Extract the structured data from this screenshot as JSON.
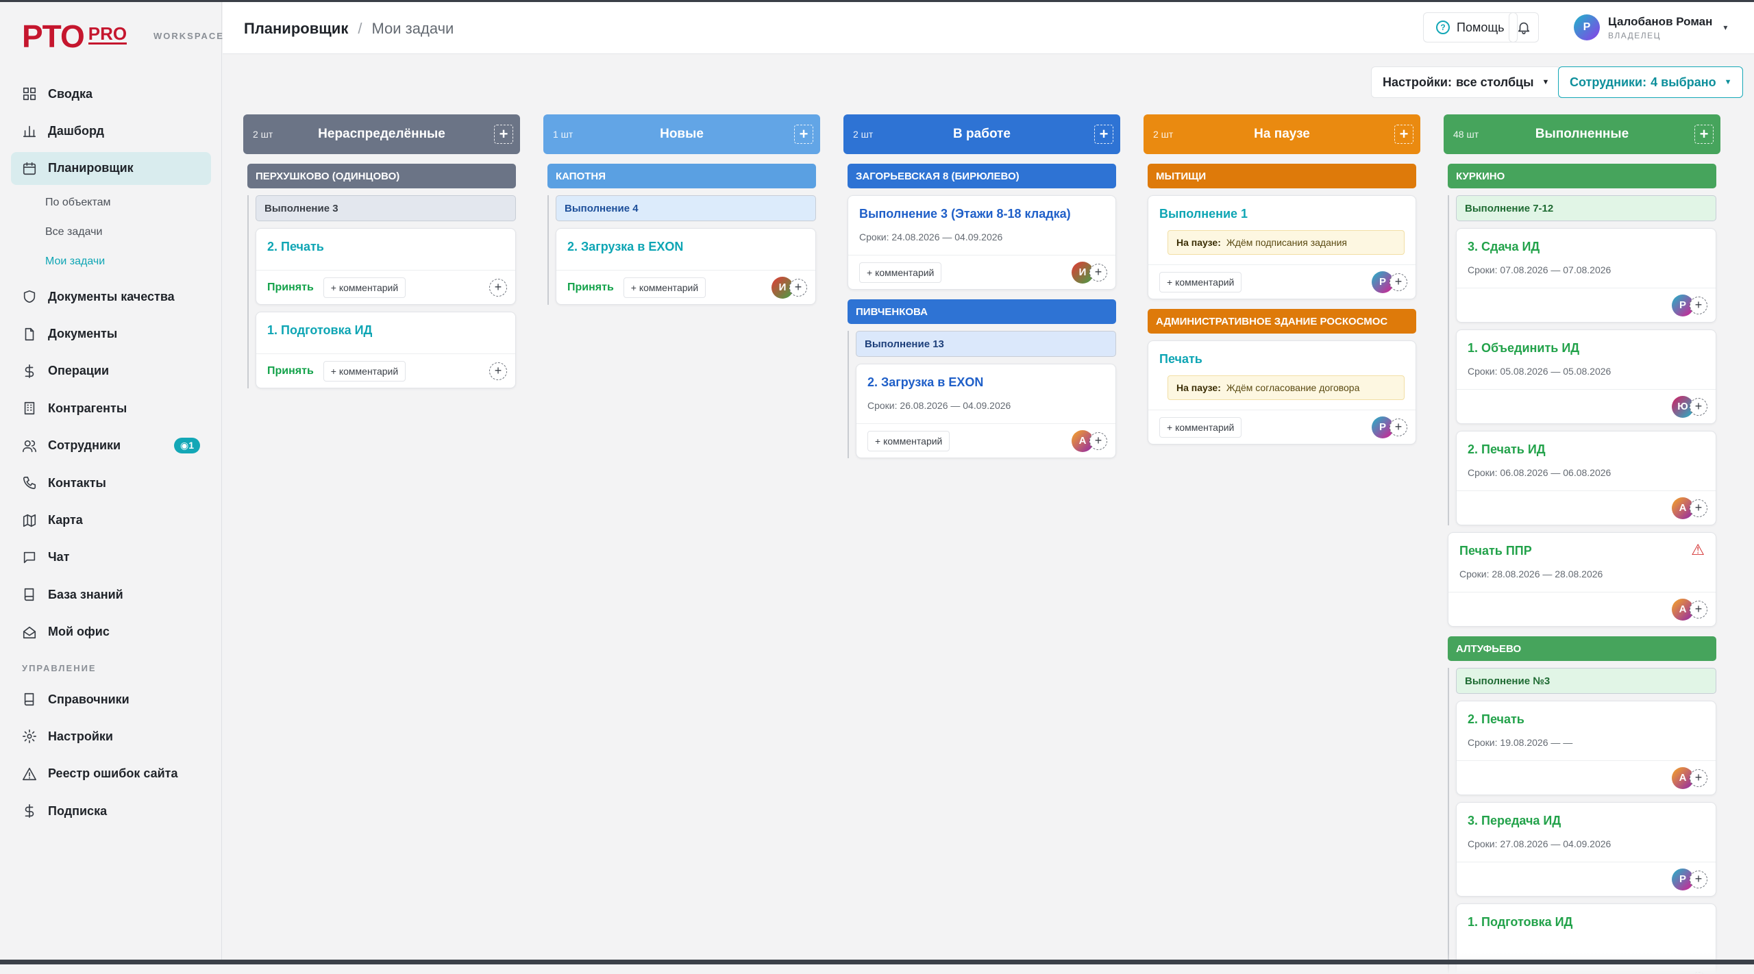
{
  "brand": {
    "name": "PTO",
    "suffix": "PRO",
    "tagline": "WORKSPACE",
    "color": "#c5162e"
  },
  "nav": [
    {
      "label": "Сводка",
      "icon": "grid-icon"
    },
    {
      "label": "Дашборд",
      "icon": "bar-chart-icon"
    },
    {
      "label": "Планировщик",
      "icon": "calendar-icon",
      "active": true
    },
    {
      "label": "Документы качества",
      "icon": "shield-icon"
    },
    {
      "label": "Документы",
      "icon": "file-icon"
    },
    {
      "label": "Операции",
      "icon": "dollar-icon"
    },
    {
      "label": "Контрагенты",
      "icon": "building-icon"
    },
    {
      "label": "Сотрудники",
      "icon": "users-icon",
      "badge": "◉1"
    },
    {
      "label": "Контакты",
      "icon": "phone-icon"
    },
    {
      "label": "Карта",
      "icon": "map-icon"
    },
    {
      "label": "Чат",
      "icon": "chat-icon"
    },
    {
      "label": "База знаний",
      "icon": "book-icon"
    },
    {
      "label": "Мой офис",
      "icon": "office-icon"
    }
  ],
  "subnav": [
    "По объектам",
    "Все задачи",
    "Мои задачи"
  ],
  "management": {
    "title": "УПРАВЛЕНИЕ",
    "items": [
      {
        "label": "Справочники",
        "icon": "book-icon"
      },
      {
        "label": "Настройки",
        "icon": "gear-icon"
      },
      {
        "label": "Реестр ошибок сайта",
        "icon": "warning-icon"
      },
      {
        "label": "Подписка",
        "icon": "dollar-icon"
      }
    ]
  },
  "header": {
    "crumb1": "Планировщик",
    "sep": "/",
    "crumb2": "Мои задачи",
    "help": "Помощь",
    "help_q": "?",
    "user_name": "Цалобанов Роман",
    "user_role": "ВЛАДЕЛЕЦ",
    "user_initial": "Р"
  },
  "controls": {
    "settings_label": "Настройки:",
    "settings_value": "все столбцы",
    "staff_label": "Сотрудники:",
    "staff_value": "4 выбрано"
  },
  "accept": "Принять",
  "comment": "+ комментарий",
  "pause_label": "На паузе:",
  "columns": [
    {
      "count": "2 шт",
      "title": "Нераспределённые",
      "color": "#6b7486",
      "groups": [
        {
          "name": "ПЕРХУШКОВО (ОДИНЦОВО)",
          "stages": [
            {
              "name": "Выполнение 3",
              "cards": [
                {
                  "title": "2. Печать",
                  "accept": true,
                  "avatars": []
                },
                {
                  "title": "1. Подготовка ИД",
                  "accept": true,
                  "avatars": []
                }
              ]
            }
          ]
        }
      ]
    },
    {
      "count": "1 шт",
      "title": "Новые",
      "color": "#62a5e6",
      "groups": [
        {
          "name": "КАПОТНЯ",
          "stages": [
            {
              "name": "Выполнение 4",
              "cards": [
                {
                  "title": "2. Загрузка в EXON",
                  "accept": true,
                  "avatars": [
                    {
                      "l": "И",
                      "g": "g-red"
                    }
                  ]
                }
              ]
            }
          ]
        }
      ]
    },
    {
      "count": "2 шт",
      "title": "В работе",
      "color": "#2e73d4",
      "groups": [
        {
          "name": "ЗАГОРЬЕВСКАЯ 8 (БИРЮЛЕВО)",
          "cards": [
            {
              "title": "Выполнение 3 (Этажи 8-18 кладка)",
              "dates": "Сроки: 24.08.2026 — 04.09.2026",
              "avatars": [
                {
                  "l": "И",
                  "g": "g-red"
                }
              ]
            }
          ]
        },
        {
          "name": "ПИВЧЕНКОВА",
          "stages": [
            {
              "name": "Выполнение 13",
              "cards": [
                {
                  "title": "2. Загрузка в EXON",
                  "dates": "Сроки: 26.08.2026 — 04.09.2026",
                  "avatars": [
                    {
                      "l": "А",
                      "g": "g-vio"
                    }
                  ]
                }
              ]
            }
          ]
        }
      ]
    },
    {
      "count": "2 шт",
      "title": "На паузе",
      "color": "#ea8a10",
      "groups": [
        {
          "name": "МЫТИЩИ",
          "cards": [
            {
              "title": "Выполнение 1",
              "pause": "Ждём подписания задания",
              "avatars": [
                {
                  "l": "Р",
                  "g": "g-teal"
                }
              ]
            }
          ]
        },
        {
          "name": "АДМИНИСТРАТИВНОЕ ЗДАНИЕ РОСКОСМОС",
          "cards": [
            {
              "title": "Печать",
              "pause": "Ждём согласование договора",
              "avatars": [
                {
                  "l": "Р",
                  "g": "g-teal"
                }
              ]
            }
          ]
        }
      ]
    },
    {
      "count": "48 шт",
      "title": "Выполненные",
      "color": "#46a45c",
      "groups": [
        {
          "name": "КУРКИНО",
          "stages": [
            {
              "name": "Выполнение 7-12",
              "cards": [
                {
                  "title": "3. Сдача ИД",
                  "dates": "Сроки: 07.08.2026 — 07.08.2026",
                  "avatars": [
                    {
                      "l": "Р",
                      "g": "g-teal"
                    }
                  ]
                },
                {
                  "title": "1. Объединить ИД",
                  "dates": "Сроки: 05.08.2026 — 05.08.2026",
                  "avatars": [
                    {
                      "l": "Ю",
                      "g": "g-pink"
                    }
                  ]
                },
                {
                  "title": "2. Печать ИД",
                  "dates": "Сроки: 06.08.2026 — 06.08.2026",
                  "avatars": [
                    {
                      "l": "А",
                      "g": "g-vio"
                    }
                  ]
                }
              ]
            }
          ],
          "cards": [
            {
              "title": "Печать ППР",
              "dates": "Сроки: 28.08.2026 — 28.08.2026",
              "warn": "⚠",
              "avatars": [
                {
                  "l": "А",
                  "g": "g-vio"
                }
              ]
            }
          ]
        },
        {
          "name": "АЛТУФЬЕВО",
          "stages": [
            {
              "name": "Выполнение №3",
              "cards": [
                {
                  "title": "2. Печать",
                  "dates": "Сроки: 19.08.2026 — —",
                  "avatars": [
                    {
                      "l": "А",
                      "g": "g-vio"
                    }
                  ]
                },
                {
                  "title": "3. Передача ИД",
                  "dates": "Сроки: 27.08.2026 — 04.09.2026",
                  "avatars": [
                    {
                      "l": "Р",
                      "g": "g-teal"
                    }
                  ]
                },
                {
                  "title": "1. Подготовка ИД",
                  "dates": "",
                  "avatars": []
                }
              ]
            }
          ]
        }
      ]
    }
  ],
  "styles": {
    "Нераспределённые": {
      "grp": "#6b7486",
      "stage_bg": "#e3e7ee",
      "stage_text": "#3b4048",
      "title": "#0ea5b4"
    },
    "Новые": {
      "grp": "#5aa0e2",
      "stage_bg": "#dcebfb",
      "stage_text": "#1d4f9a",
      "title": "#0ea5b4"
    },
    "В работе": {
      "grp": "#2e73d4",
      "stage_bg": "#dbe8fb",
      "stage_text": "#1d3f7a",
      "title": "#1f5fc8"
    },
    "На паузе": {
      "grp": "#de7a0a",
      "stage_bg": "#fdebd4",
      "stage_text": "#7a4a08",
      "title": "#0ea5b4"
    },
    "Выполненные": {
      "grp": "#46a45c",
      "stage_bg": "#e1f5e6",
      "stage_text": "#1f6b33",
      "title": "#22a24a"
    }
  }
}
